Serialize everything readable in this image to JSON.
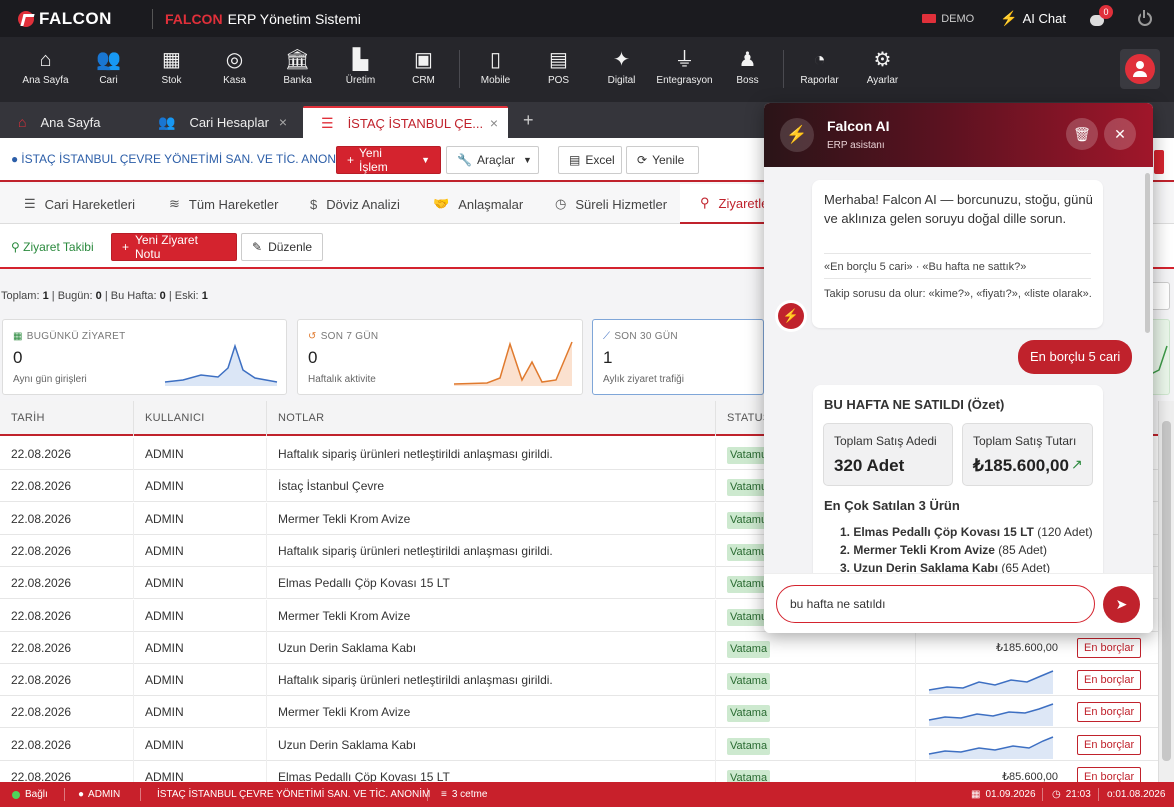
{
  "titlebar": {
    "logo": "FALCON",
    "brand": "FALCON",
    "app_title": "ERP Yönetim Sistemi",
    "demo_label": "DEMO",
    "ai_chat_label": "AI Chat",
    "notification_count": "0"
  },
  "modules": [
    {
      "label": "Ana Sayfa",
      "icon": "home-icon",
      "glyph": "⌂"
    },
    {
      "label": "Cari",
      "icon": "users-icon",
      "glyph": "👥"
    },
    {
      "label": "Stok",
      "icon": "boxes-icon",
      "glyph": "▦"
    },
    {
      "label": "Kasa",
      "icon": "coins-icon",
      "glyph": "◎"
    },
    {
      "label": "Banka",
      "icon": "bank-icon",
      "glyph": "🏛"
    },
    {
      "label": "Üretim",
      "icon": "factory-icon",
      "glyph": "▙"
    },
    {
      "label": "CRM",
      "icon": "address-book-icon",
      "glyph": "▣"
    },
    {
      "label": "Mobile",
      "icon": "mobile-icon",
      "glyph": "▯"
    },
    {
      "label": "POS",
      "icon": "cash-register-icon",
      "glyph": "▤"
    },
    {
      "label": "Digital",
      "icon": "magic-wand-icon",
      "glyph": "✦"
    },
    {
      "label": "Entegrasyon",
      "icon": "plug-icon",
      "glyph": "⏚"
    },
    {
      "label": "Boss",
      "icon": "user-tie-icon",
      "glyph": "♟"
    },
    {
      "label": "Raporlar",
      "icon": "pie-chart-icon",
      "glyph": "◔"
    },
    {
      "label": "Ayarlar",
      "icon": "gear-icon",
      "glyph": "⚙"
    }
  ],
  "tabs": [
    {
      "label": "Ana Sayfa"
    },
    {
      "label": "Cari Hesaplar"
    },
    {
      "label": "İSTAÇ İSTANBUL ÇE..."
    }
  ],
  "customer": {
    "name": "İSTAÇ İSTANBUL ÇEVRE YÖNETİMİ SAN. VE TİC. ANONİM",
    "new_action": "Yeni İşlem",
    "tools": "Araçlar",
    "excel": "Excel",
    "refresh": "Yenile"
  },
  "subtabs": [
    {
      "label": "Cari Hareketleri"
    },
    {
      "label": "Tüm Hareketler"
    },
    {
      "label": "Döviz Analizi"
    },
    {
      "label": "Anlaşmalar"
    },
    {
      "label": "Süreli Hizmetler"
    },
    {
      "label": "Ziyaretler"
    }
  ],
  "visit": {
    "title": "Ziyaret Takibi",
    "new_note": "Yeni Ziyaret Notu",
    "edit": "Düzenle",
    "right_fragment": "ki"
  },
  "stats": {
    "total_label": "Toplam:",
    "total": "1",
    "today_label": "Bugün:",
    "today": "0",
    "week_label": "Bu Hafta:",
    "week": "0",
    "old_label": "Eski:",
    "old": "1"
  },
  "cards": [
    {
      "title": "BUGÜNKÜ ZİYARET",
      "value": "0",
      "sub": "Aynı gün girişleri",
      "color": "#3d6fc2"
    },
    {
      "title": "SON 7 GÜN",
      "value": "0",
      "sub": "Haftalık aktivite",
      "color": "#e07a2e"
    },
    {
      "title": "SON 30 GÜN",
      "value": "1",
      "sub": "Aylık ziyaret trafiği",
      "color": "#3d6fc2"
    }
  ],
  "table": {
    "headers": [
      "TARİH",
      "KULLANICI",
      "NOTLAR",
      "STATUS"
    ],
    "rows": [
      {
        "date": "22.08.2026",
        "user": "ADMIN",
        "note": "Haftalık sipariş ürünleri netleştirildi anlaşması girildi.",
        "status": "Vatamu"
      },
      {
        "date": "22.08.2026",
        "user": "ADMIN",
        "note": "İstaç İstanbul Çevre",
        "status": "Vatamu"
      },
      {
        "date": "22.08.2026",
        "user": "ADMIN",
        "note": "Mermer Tekli Krom Avize",
        "status": "Vatamu"
      },
      {
        "date": "22.08.2026",
        "user": "ADMIN",
        "note": "Haftalık sipariş ürünleri netleştirildi anlaşması girildi.",
        "status": "Vatamu"
      },
      {
        "date": "22.08.2026",
        "user": "ADMIN",
        "note": "Elmas Pedallı Çöp Kovası 15 LT",
        "status": "Vatamu"
      },
      {
        "date": "22.08.2026",
        "user": "ADMIN",
        "note": "Mermer Tekli Krom Avize",
        "status": "Vatamu"
      },
      {
        "date": "22.08.2026",
        "user": "ADMIN",
        "note": "Uzun Derin Saklama Kabı",
        "status": "Vatama",
        "amount": "₺185.600,00",
        "button": "En borçlar"
      },
      {
        "date": "22.08.2026",
        "user": "ADMIN",
        "note": "Haftalık sipariş ürünleri netleştirildi anlaşması girildi.",
        "status": "Vatama",
        "button": "En borçlar"
      },
      {
        "date": "22.08.2026",
        "user": "ADMIN",
        "note": "Mermer Tekli Krom Avize",
        "status": "Vatama",
        "button": "En borçlar"
      },
      {
        "date": "22.08.2026",
        "user": "ADMIN",
        "note": "Uzun Derin Saklama Kabı",
        "status": "Vatama",
        "button": "En borçlar"
      },
      {
        "date": "22.08.2026",
        "user": "ADMIN",
        "note": "Elmas Pedallı  Çöp Kovası 15 LT",
        "status": "Vatama",
        "amount": "₺85.600,00",
        "button": "En borçlar"
      }
    ]
  },
  "statusbar": {
    "connection": "Bağlı",
    "user": "ADMIN",
    "company": "İSTAÇ İSTANBUL ÇEVRE YÖNETİMİ SAN. VE TİC. ANONİM",
    "db": "3 cetme",
    "date": "01.09.2026",
    "time": "21:03",
    "version": "o:01.08.2026"
  },
  "ai": {
    "title": "Falcon AI",
    "subtitle": "ERP asistanı",
    "welcome": "Merhaba! Falcon AI — borcunuzu, stoğu, günü ve aklınıza gelen soruyu doğal dille sorun.",
    "examples": "«En borçlu 5 cari» · «Bu hafta ne sattık?»",
    "followup": "Takip sorusu da olur: «kime?», «fiyatı?», «liste olarak».",
    "user_msg": "En borçlu 5 cari",
    "summary_title": "BU HAFTA NE SATILDI (Özet)",
    "kpi_qty_label": "Toplam Satış Adedi",
    "kpi_qty_value": "320 Adet",
    "kpi_amount_label": "Toplam Satış Tutarı",
    "kpi_amount_value": "₺185.600,00",
    "top_title": "En Çok Satılan 3 Ürün",
    "top_items": [
      {
        "name": "1. Elmas Pedallı Çöp Kovası 15 LT",
        "qty": "(120 Adet)"
      },
      {
        "name": "2. Mermer Tekli Krom Avize",
        "qty": "(85 Adet)"
      },
      {
        "name": "3. Uzun Derin Saklama Kabı",
        "qty": "(65 Adet)"
      }
    ],
    "input_value": "bu hafta ne satıldı"
  }
}
